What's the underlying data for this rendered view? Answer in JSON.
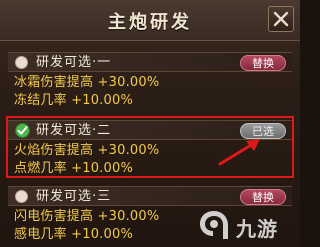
{
  "window": {
    "title": "主炮研发",
    "close_icon": "close-x-icon"
  },
  "options": [
    {
      "label": "研发可选·一",
      "selected": false,
      "button": "替换",
      "stats": [
        "冰霜伤害提高 +30.00%",
        "冻结几率 +10.00%"
      ]
    },
    {
      "label": "研发可选·二",
      "selected": true,
      "button": "已选",
      "stats": [
        "火焰伤害提高 +30.00%",
        "点燃几率 +10.00%"
      ]
    },
    {
      "label": "研发可选·三",
      "selected": false,
      "button": "替换",
      "stats": [
        "闪电伤害提高 +30.00%",
        "感电几率 +10.00%"
      ]
    }
  ],
  "watermark": {
    "text": "九游"
  },
  "colors": {
    "stat_text": "#f3c94b",
    "replace_button": "#a33a4f",
    "selected_button": "#8a8a8a",
    "check": "#4cb648",
    "annotation": "#e01818"
  }
}
